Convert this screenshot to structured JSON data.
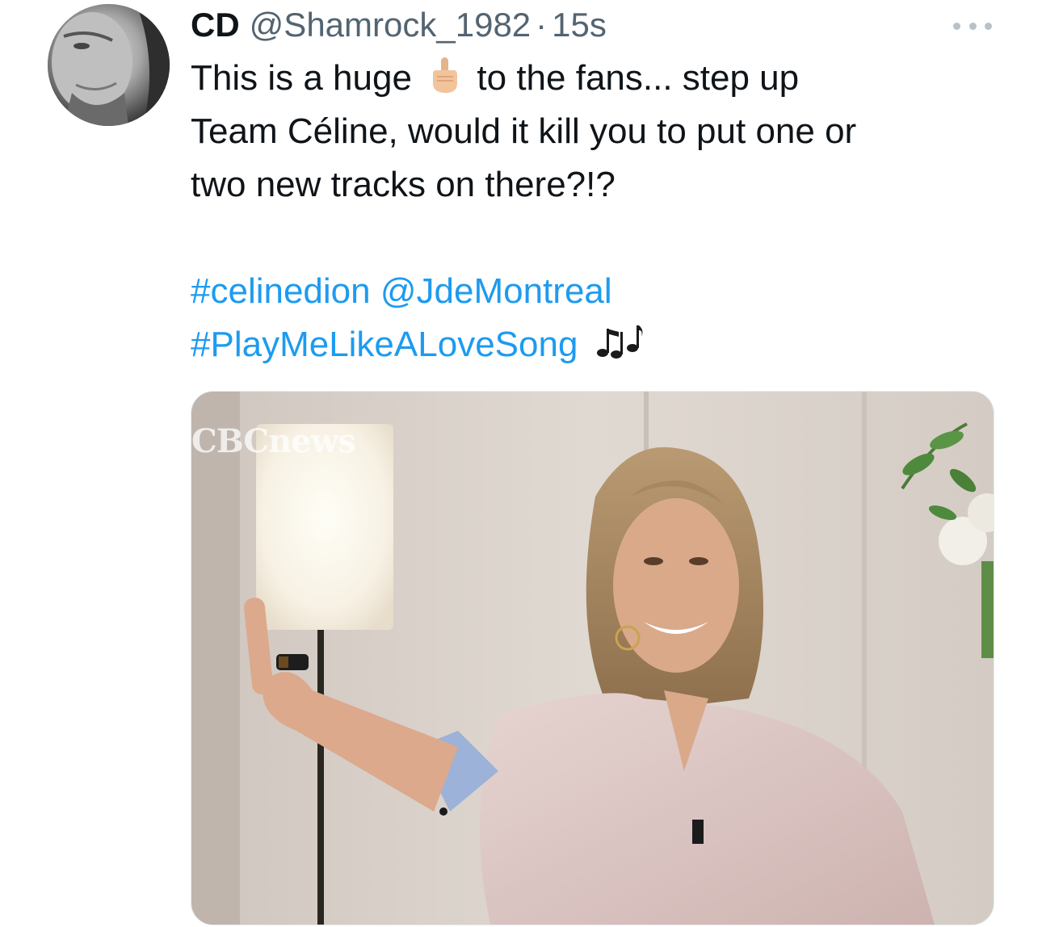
{
  "author": {
    "display_name": "CD",
    "handle": "@Shamrock_1982",
    "separator": "·",
    "timestamp": "15s"
  },
  "tweet": {
    "line1_before_emoji": "This is a huge",
    "line1_after_emoji": "to the fans... step up",
    "line2": "Team Céline, would it kill you to put one or",
    "line3": "two new tracks on there?!?",
    "hashtag1": "#celinedion",
    "mention1": "@JdeMontreal",
    "hashtag2": "#PlayMeLikeALoveSong",
    "emoji_middle_finger": "middle-finger-emoji",
    "emoji_notes": "musical-notes-emoji"
  },
  "media": {
    "watermark": "CBCnews"
  },
  "colors": {
    "link": "#1d9bf0",
    "secondary_text": "#536471",
    "primary_text": "#0f1419"
  }
}
